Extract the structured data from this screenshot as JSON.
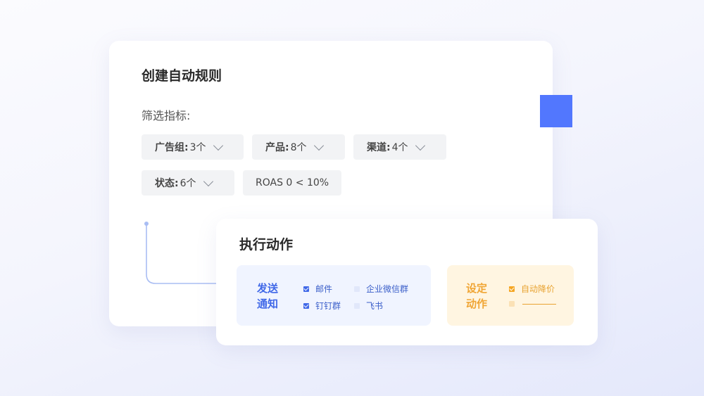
{
  "rule_card": {
    "title": "创建自动规则",
    "filter_label": "筛选指标:",
    "chips": [
      {
        "label": "广告组:",
        "count": "3个"
      },
      {
        "label": "产品:",
        "count": "8个"
      },
      {
        "label": "渠道:",
        "count": "4个"
      },
      {
        "label": "状态:",
        "count": "6个"
      }
    ],
    "roas_chip": "ROAS 0 < 10%"
  },
  "action_card": {
    "title": "执行动作",
    "notify": {
      "label": "发送通知",
      "options": [
        {
          "label": "邮件",
          "checked": true
        },
        {
          "label": "企业微信群",
          "checked": false
        },
        {
          "label": "钉钉群",
          "checked": true
        },
        {
          "label": "飞书",
          "checked": false
        }
      ]
    },
    "set_action": {
      "label": "设定动作",
      "options": [
        {
          "label": "自动降价",
          "checked": true
        },
        {
          "label": "",
          "checked": false
        }
      ]
    }
  },
  "colors": {
    "accent_blue": "#5277fe",
    "notify_blue": "#4169e8",
    "action_orange": "#f0a534",
    "connector": "#a9bdf3"
  }
}
